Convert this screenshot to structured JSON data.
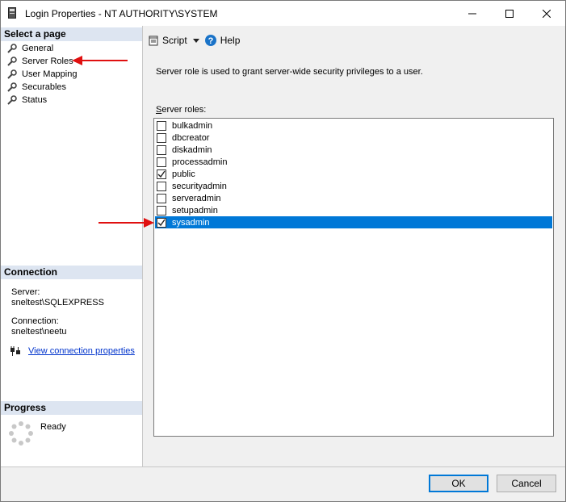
{
  "window": {
    "title": "Login Properties - NT AUTHORITY\\SYSTEM",
    "controls": [
      "minimize-icon",
      "maximize-icon",
      "close-icon"
    ]
  },
  "left": {
    "select_page_header": "Select a page",
    "nav_items": [
      {
        "label": "General",
        "icon": "wrench-icon"
      },
      {
        "label": "Server Roles",
        "icon": "wrench-icon"
      },
      {
        "label": "User Mapping",
        "icon": "wrench-icon"
      },
      {
        "label": "Securables",
        "icon": "wrench-icon"
      },
      {
        "label": "Status",
        "icon": "wrench-icon"
      }
    ],
    "connection_header": "Connection",
    "server_label": "Server:",
    "server_value": "sneltest\\SQLEXPRESS",
    "connection_label": "Connection:",
    "connection_value": "sneltest\\neetu",
    "view_link": "View connection properties",
    "progress_header": "Progress",
    "progress_status": "Ready"
  },
  "toolbar": {
    "script_label": "Script",
    "help_label": "Help"
  },
  "main": {
    "description": "Server role is used to grant server-wide security privileges to a user.",
    "roles_label_prefix": "S",
    "roles_label_rest": "erver roles:",
    "roles": [
      {
        "name": "bulkadmin",
        "checked": false,
        "selected": false
      },
      {
        "name": "dbcreator",
        "checked": false,
        "selected": false
      },
      {
        "name": "diskadmin",
        "checked": false,
        "selected": false
      },
      {
        "name": "processadmin",
        "checked": false,
        "selected": false
      },
      {
        "name": "public",
        "checked": true,
        "selected": false
      },
      {
        "name": "securityadmin",
        "checked": false,
        "selected": false
      },
      {
        "name": "serveradmin",
        "checked": false,
        "selected": false
      },
      {
        "name": "setupadmin",
        "checked": false,
        "selected": false
      },
      {
        "name": "sysadmin",
        "checked": true,
        "selected": true
      }
    ]
  },
  "buttons": {
    "ok": "OK",
    "cancel": "Cancel"
  },
  "colors": {
    "selection": "#0078d7",
    "section_header": "#dde5f1",
    "annotation_arrow": "#e01010",
    "link": "#0033cc"
  }
}
